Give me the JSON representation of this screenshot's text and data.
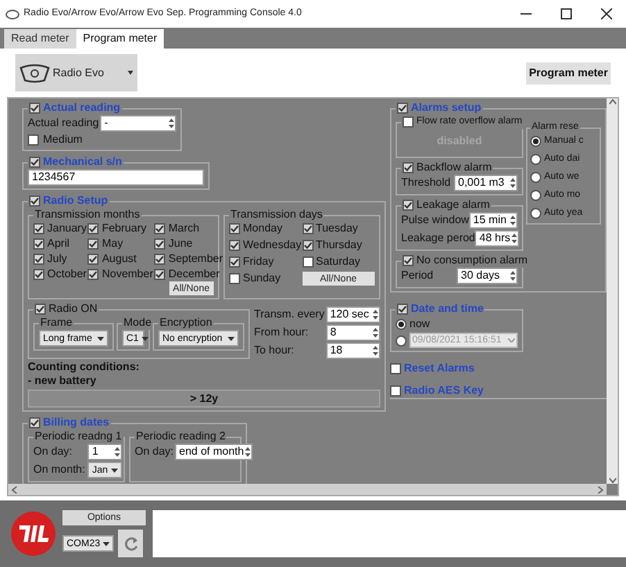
{
  "window": {
    "title": "Radio Evo/Arrow Evo/Arrow Evo Sep. Programming Console 4.0"
  },
  "tabs": [
    {
      "label": "Read meter",
      "selected": false
    },
    {
      "label": "Program meter",
      "selected": true
    }
  ],
  "device_select": {
    "value": "Radio Evo"
  },
  "program_button": "Program meter",
  "actual_reading": {
    "title": "Actual reading",
    "enabled": true,
    "label": "Actual reading",
    "value": "-",
    "medium_label": "Medium",
    "medium": false
  },
  "mechanical_sn": {
    "title": "Mechanical s/n",
    "enabled": true,
    "value": "1234567"
  },
  "radio_setup": {
    "title": "Radio Setup",
    "enabled": true,
    "months_title": "Transmission months",
    "months": [
      {
        "label": "January",
        "checked": true
      },
      {
        "label": "February",
        "checked": true
      },
      {
        "label": "March",
        "checked": true
      },
      {
        "label": "April",
        "checked": true
      },
      {
        "label": "May",
        "checked": true
      },
      {
        "label": "June",
        "checked": true
      },
      {
        "label": "July",
        "checked": true
      },
      {
        "label": "August",
        "checked": true
      },
      {
        "label": "September",
        "checked": true
      },
      {
        "label": "October",
        "checked": true
      },
      {
        "label": "November",
        "checked": true
      },
      {
        "label": "December",
        "checked": true
      }
    ],
    "months_button": "All/None",
    "days_title": "Transmission days",
    "days": [
      {
        "label": "Monday",
        "checked": true
      },
      {
        "label": "Tuesday",
        "checked": true
      },
      {
        "label": "Wednesday",
        "checked": true
      },
      {
        "label": "Thursday",
        "checked": true
      },
      {
        "label": "Friday",
        "checked": true
      },
      {
        "label": "Saturday",
        "checked": false
      },
      {
        "label": "Sunday",
        "checked": false
      }
    ],
    "days_button": "All/None",
    "radio_on": {
      "label": "Radio ON",
      "checked": true,
      "frame_label": "Frame",
      "frame": "Long frame",
      "mode_label": "Mode",
      "mode": "C1",
      "encryption_label": "Encryption",
      "encryption": "No encryption"
    },
    "transm_label": "Transm. every",
    "transm": "120 sec",
    "from_label": "From hour:",
    "from": "8",
    "to_label": "To hour:",
    "to": "18",
    "counting_title": "Counting conditions:",
    "counting_item": "- new battery",
    "lifetime": "> 12y"
  },
  "billing": {
    "title": "Billing dates",
    "enabled": true,
    "periodic_1": {
      "title": "Periodic readng 1",
      "day_label": "On day:",
      "day": "1",
      "month_label": "On month:",
      "month": "Jan"
    },
    "periodic_2": {
      "title": "Periodic reading 2",
      "day_label": "On day:",
      "day": "end of month"
    }
  },
  "alarms": {
    "title": "Alarms setup",
    "enabled": true,
    "flow": {
      "label": "Flow rate overflow alarm",
      "checked": false,
      "status": "disabled"
    },
    "backflow": {
      "label": "Backflow alarm",
      "checked": true,
      "threshold_label": "Threshold",
      "threshold": "0,001 m3"
    },
    "leakage": {
      "label": "Leakage alarm",
      "checked": true,
      "pulse_label": "Pulse window",
      "pulse": "15 min",
      "period_label": "Leakage perod",
      "period": "48 hrs"
    },
    "no_consumption": {
      "label": "No consumption alarm",
      "checked": true,
      "period_label": "Period",
      "period": "30 days"
    },
    "reset": {
      "title": "Alarm rese",
      "options": [
        {
          "label": "Manual c",
          "selected": true
        },
        {
          "label": "Auto dai",
          "selected": false
        },
        {
          "label": "Auto we",
          "selected": false
        },
        {
          "label": "Auto mo",
          "selected": false
        },
        {
          "label": "Auto yea",
          "selected": false
        }
      ]
    }
  },
  "date_time": {
    "title": "Date and time",
    "enabled": true,
    "options": [
      {
        "label": "now",
        "selected": true
      },
      {
        "label": "09/08/2021 15:16:51",
        "selected": false
      }
    ]
  },
  "reset_alarms": {
    "label": "Reset Alarms",
    "checked": false
  },
  "aes_key": {
    "label": "Radio AES Key",
    "checked": false
  },
  "footer": {
    "options_button": "Options",
    "port": "COM23"
  }
}
